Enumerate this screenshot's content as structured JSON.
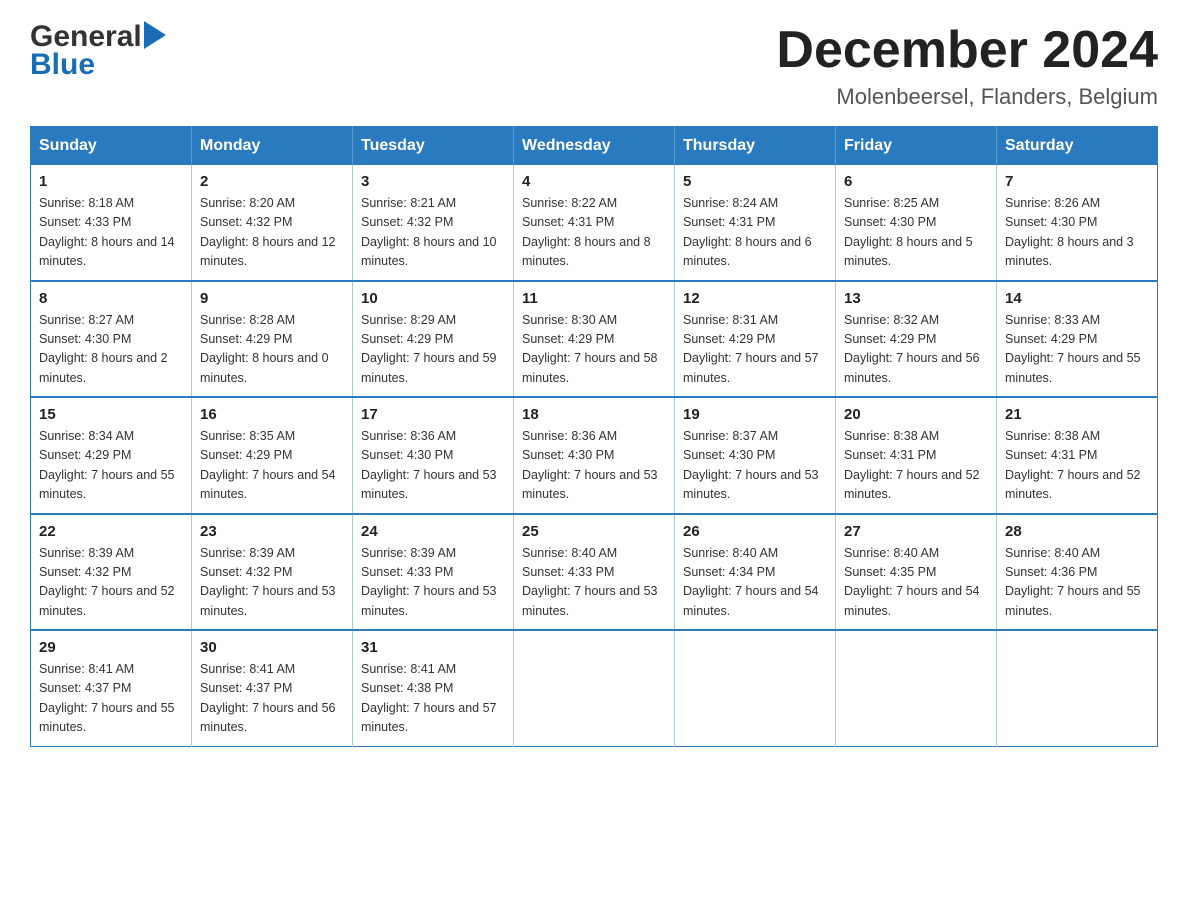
{
  "header": {
    "logo_general": "General",
    "logo_blue": "Blue",
    "title": "December 2024",
    "subtitle": "Molenbeersel, Flanders, Belgium"
  },
  "calendar": {
    "days_of_week": [
      "Sunday",
      "Monday",
      "Tuesday",
      "Wednesday",
      "Thursday",
      "Friday",
      "Saturday"
    ],
    "weeks": [
      [
        {
          "day": "1",
          "sunrise": "8:18 AM",
          "sunset": "4:33 PM",
          "daylight": "8 hours and 14 minutes."
        },
        {
          "day": "2",
          "sunrise": "8:20 AM",
          "sunset": "4:32 PM",
          "daylight": "8 hours and 12 minutes."
        },
        {
          "day": "3",
          "sunrise": "8:21 AM",
          "sunset": "4:32 PM",
          "daylight": "8 hours and 10 minutes."
        },
        {
          "day": "4",
          "sunrise": "8:22 AM",
          "sunset": "4:31 PM",
          "daylight": "8 hours and 8 minutes."
        },
        {
          "day": "5",
          "sunrise": "8:24 AM",
          "sunset": "4:31 PM",
          "daylight": "8 hours and 6 minutes."
        },
        {
          "day": "6",
          "sunrise": "8:25 AM",
          "sunset": "4:30 PM",
          "daylight": "8 hours and 5 minutes."
        },
        {
          "day": "7",
          "sunrise": "8:26 AM",
          "sunset": "4:30 PM",
          "daylight": "8 hours and 3 minutes."
        }
      ],
      [
        {
          "day": "8",
          "sunrise": "8:27 AM",
          "sunset": "4:30 PM",
          "daylight": "8 hours and 2 minutes."
        },
        {
          "day": "9",
          "sunrise": "8:28 AM",
          "sunset": "4:29 PM",
          "daylight": "8 hours and 0 minutes."
        },
        {
          "day": "10",
          "sunrise": "8:29 AM",
          "sunset": "4:29 PM",
          "daylight": "7 hours and 59 minutes."
        },
        {
          "day": "11",
          "sunrise": "8:30 AM",
          "sunset": "4:29 PM",
          "daylight": "7 hours and 58 minutes."
        },
        {
          "day": "12",
          "sunrise": "8:31 AM",
          "sunset": "4:29 PM",
          "daylight": "7 hours and 57 minutes."
        },
        {
          "day": "13",
          "sunrise": "8:32 AM",
          "sunset": "4:29 PM",
          "daylight": "7 hours and 56 minutes."
        },
        {
          "day": "14",
          "sunrise": "8:33 AM",
          "sunset": "4:29 PM",
          "daylight": "7 hours and 55 minutes."
        }
      ],
      [
        {
          "day": "15",
          "sunrise": "8:34 AM",
          "sunset": "4:29 PM",
          "daylight": "7 hours and 55 minutes."
        },
        {
          "day": "16",
          "sunrise": "8:35 AM",
          "sunset": "4:29 PM",
          "daylight": "7 hours and 54 minutes."
        },
        {
          "day": "17",
          "sunrise": "8:36 AM",
          "sunset": "4:30 PM",
          "daylight": "7 hours and 53 minutes."
        },
        {
          "day": "18",
          "sunrise": "8:36 AM",
          "sunset": "4:30 PM",
          "daylight": "7 hours and 53 minutes."
        },
        {
          "day": "19",
          "sunrise": "8:37 AM",
          "sunset": "4:30 PM",
          "daylight": "7 hours and 53 minutes."
        },
        {
          "day": "20",
          "sunrise": "8:38 AM",
          "sunset": "4:31 PM",
          "daylight": "7 hours and 52 minutes."
        },
        {
          "day": "21",
          "sunrise": "8:38 AM",
          "sunset": "4:31 PM",
          "daylight": "7 hours and 52 minutes."
        }
      ],
      [
        {
          "day": "22",
          "sunrise": "8:39 AM",
          "sunset": "4:32 PM",
          "daylight": "7 hours and 52 minutes."
        },
        {
          "day": "23",
          "sunrise": "8:39 AM",
          "sunset": "4:32 PM",
          "daylight": "7 hours and 53 minutes."
        },
        {
          "day": "24",
          "sunrise": "8:39 AM",
          "sunset": "4:33 PM",
          "daylight": "7 hours and 53 minutes."
        },
        {
          "day": "25",
          "sunrise": "8:40 AM",
          "sunset": "4:33 PM",
          "daylight": "7 hours and 53 minutes."
        },
        {
          "day": "26",
          "sunrise": "8:40 AM",
          "sunset": "4:34 PM",
          "daylight": "7 hours and 54 minutes."
        },
        {
          "day": "27",
          "sunrise": "8:40 AM",
          "sunset": "4:35 PM",
          "daylight": "7 hours and 54 minutes."
        },
        {
          "day": "28",
          "sunrise": "8:40 AM",
          "sunset": "4:36 PM",
          "daylight": "7 hours and 55 minutes."
        }
      ],
      [
        {
          "day": "29",
          "sunrise": "8:41 AM",
          "sunset": "4:37 PM",
          "daylight": "7 hours and 55 minutes."
        },
        {
          "day": "30",
          "sunrise": "8:41 AM",
          "sunset": "4:37 PM",
          "daylight": "7 hours and 56 minutes."
        },
        {
          "day": "31",
          "sunrise": "8:41 AM",
          "sunset": "4:38 PM",
          "daylight": "7 hours and 57 minutes."
        },
        null,
        null,
        null,
        null
      ]
    ]
  }
}
